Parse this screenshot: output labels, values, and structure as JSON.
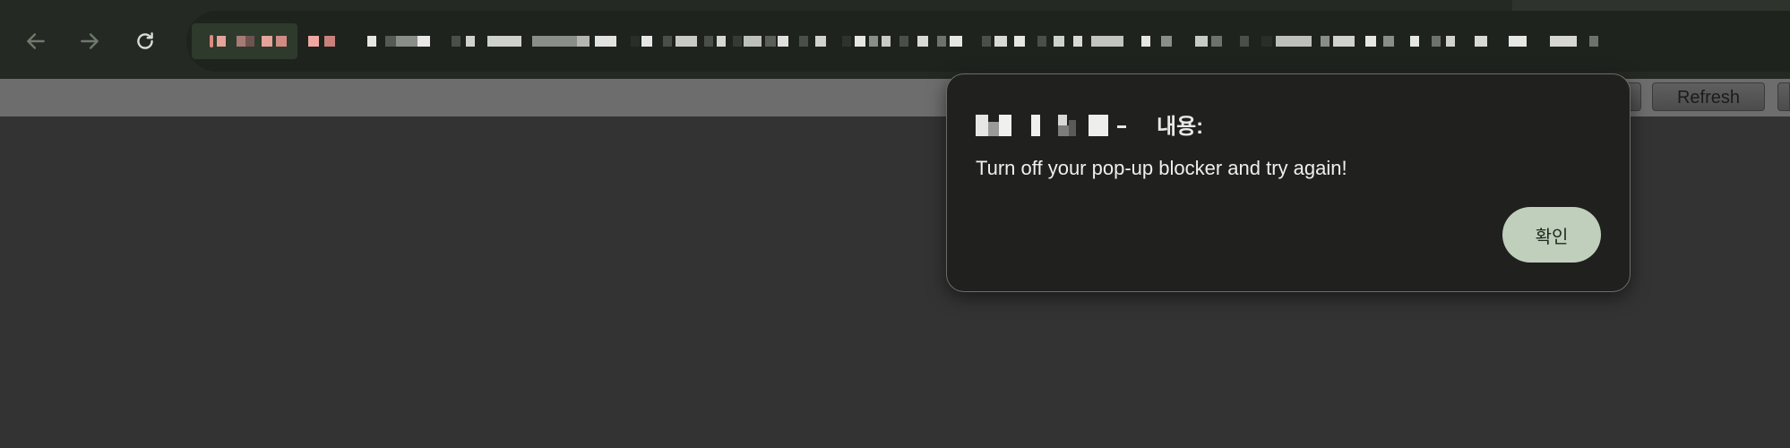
{
  "browser": {
    "nav": {
      "back_icon": "arrow-left-icon",
      "forward_icon": "arrow-right-icon",
      "reload_icon": "reload-icon"
    },
    "address_bar": {
      "note": "URL text is pixelated/obscured in the screenshot"
    }
  },
  "page": {
    "buttons": [
      {
        "label": ""
      },
      {
        "label": "Refresh"
      },
      {
        "label": ""
      }
    ]
  },
  "dialog": {
    "title_suffix": "내용:",
    "message": "Turn off your pop-up blocker and try again!",
    "ok_label": "확인"
  },
  "colors": {
    "toolbar": "#252923",
    "omnibox": "#1f231e",
    "dialog_bg": "#20201e",
    "ok_button": "#bfcfbc",
    "page_bg": "#333333"
  }
}
